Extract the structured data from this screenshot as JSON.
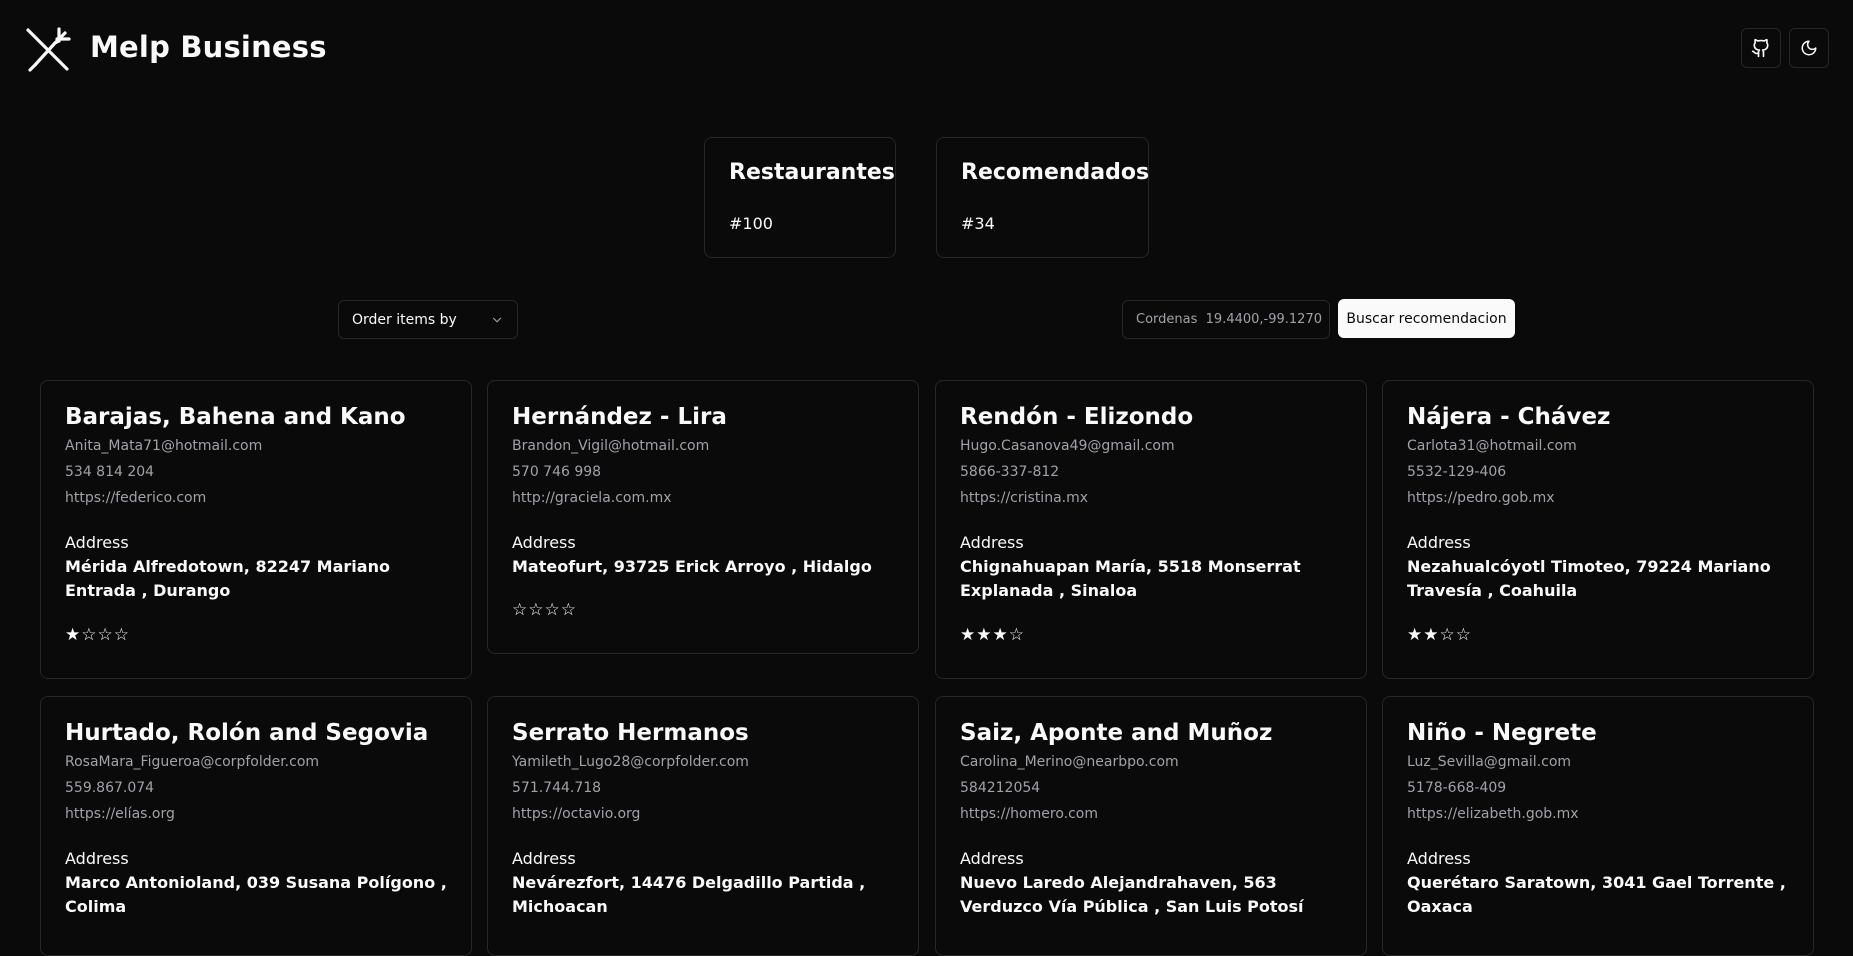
{
  "app": {
    "brand": "Melp Business"
  },
  "header": {
    "github_icon": "github-icon",
    "theme_icon": "moon-icon"
  },
  "stats": [
    {
      "title": "Restaurantes",
      "value": "#100"
    },
    {
      "title": "Recomendados",
      "value": "#34"
    }
  ],
  "controls": {
    "order_label": "Order items by",
    "coord_prefix": "Cordenas",
    "coord_value": "19.4400,-99.1270",
    "search_label": "Buscar recomendacion"
  },
  "restaurants": [
    {
      "name": "Barajas, Bahena and Kano",
      "email": "Anita_Mata71@hotmail.com",
      "phone": "534 814 204",
      "site": "https://federico.com",
      "address_label": "Address",
      "address": "Mérida Alfredotown, 82247 Mariano Entrada , Durango",
      "rating": 1
    },
    {
      "name": "Hernández - Lira",
      "email": "Brandon_Vigil@hotmail.com",
      "phone": "570 746 998",
      "site": "http://graciela.com.mx",
      "address_label": "Address",
      "address": "Mateofurt, 93725 Erick Arroyo , Hidalgo",
      "rating": 0
    },
    {
      "name": "Rendón - Elizondo",
      "email": "Hugo.Casanova49@gmail.com",
      "phone": "5866-337-812",
      "site": "https://cristina.mx",
      "address_label": "Address",
      "address": "Chignahuapan María, 5518 Monserrat Explanada , Sinaloa",
      "rating": 3
    },
    {
      "name": "Nájera - Chávez",
      "email": "Carlota31@hotmail.com",
      "phone": "5532-129-406",
      "site": "https://pedro.gob.mx",
      "address_label": "Address",
      "address": "Nezahualcóyotl Timoteo, 79224 Mariano Travesía , Coahuila",
      "rating": 2
    },
    {
      "name": "Hurtado, Rolón and Segovia",
      "email": "RosaMara_Figueroa@corpfolder.com",
      "phone": "559.867.074",
      "site": "https://elías.org",
      "address_label": "Address",
      "address": "Marco Antonioland, 039 Susana Polígono , Colima",
      "rating": null
    },
    {
      "name": "Serrato Hermanos",
      "email": "Yamileth_Lugo28@corpfolder.com",
      "phone": "571.744.718",
      "site": "https://octavio.org",
      "address_label": "Address",
      "address": "Nevárezfort, 14476 Delgadillo Partida , Michoacan",
      "rating": null
    },
    {
      "name": "Saiz, Aponte and Muñoz",
      "email": "Carolina_Merino@nearbpo.com",
      "phone": "584212054",
      "site": "https://homero.com",
      "address_label": "Address",
      "address": "Nuevo Laredo Alejandrahaven, 563 Verduzco Vía Pública , San Luis Potosí",
      "rating": null
    },
    {
      "name": "Niño - Negrete",
      "email": "Luz_Sevilla@gmail.com",
      "phone": "5178-668-409",
      "site": "https://elizabeth.gob.mx",
      "address_label": "Address",
      "address": "Querétaro Saratown, 3041 Gael Torrente , Oaxaca",
      "rating": null
    }
  ]
}
